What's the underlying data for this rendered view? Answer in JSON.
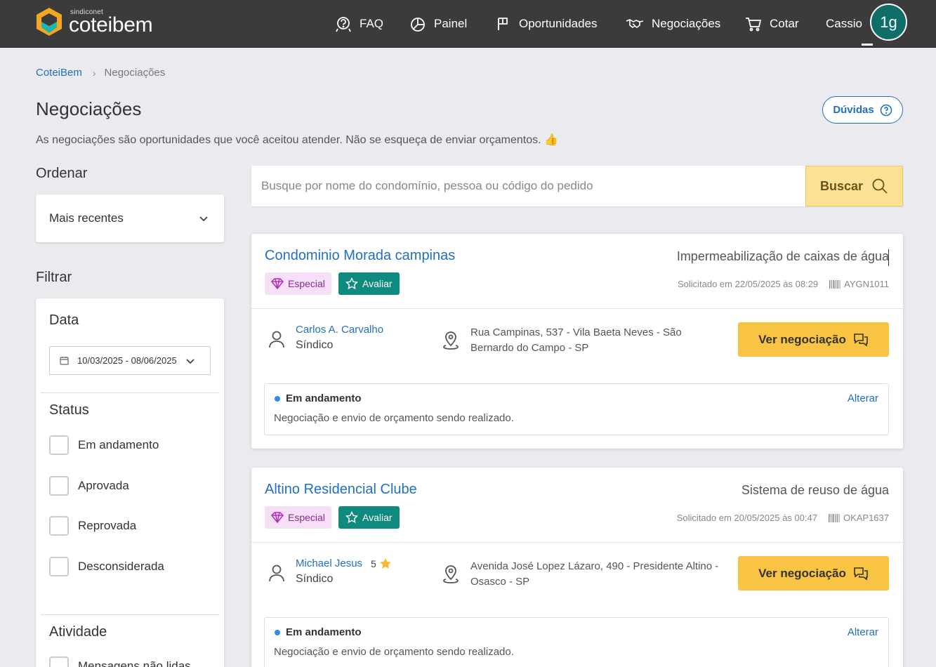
{
  "header": {
    "brand_small": "sindiconet",
    "brand_name": "coteibem",
    "nav": {
      "faq": "FAQ",
      "painel": "Painel",
      "oportunidades": "Oportunidades",
      "negociacoes": "Negociações",
      "cotar": "Cotar"
    },
    "user_name": "Cassio",
    "avatar_initials": "1g"
  },
  "breadcrumb": {
    "home": "CoteiBem",
    "separator": "›",
    "current": "Negociações"
  },
  "page": {
    "title": "Negociações",
    "subtitle": "As negociações são oportunidades que você aceitou atender. Não se esqueça de enviar orçamentos. 👍",
    "help_button": "Dúvidas"
  },
  "sidebar": {
    "sort_label": "Ordenar",
    "sort_value": "Mais recentes",
    "filter_label": "Filtrar",
    "date_label": "Data",
    "date_range": "10/03/2025 - 08/06/2025",
    "status_label": "Status",
    "status_options": [
      "Em andamento",
      "Aprovada",
      "Reprovada",
      "Desconsiderada"
    ],
    "activity_label": "Atividade",
    "activity_options": [
      "Mensagens não lidas"
    ]
  },
  "search": {
    "placeholder": "Busque por nome do condomínio, pessoa ou código do pedido",
    "button": "Buscar"
  },
  "cards": [
    {
      "title": "Condominio Morada campinas",
      "service": "Impermeabilização de caixas de água",
      "tag_especial": "Especial",
      "tag_avaliar": "Avaliar",
      "requested": "Solicitado em 22/05/2025 às 08:29",
      "code": "AYGN1011",
      "person": "Carlos A. Carvalho",
      "role": "Síndico",
      "rating": "",
      "address": "Rua Campinas, 537 - Vila Baeta Neves - São Bernardo do Campo - SP",
      "action": "Ver negociação",
      "status": "Em andamento",
      "status_desc": "Negociação e envio de orçamento sendo realizado.",
      "change": "Alterar"
    },
    {
      "title": "Altino Residencial Clube",
      "service": "Sistema de reuso de água",
      "tag_especial": "Especial",
      "tag_avaliar": "Avaliar",
      "requested": "Solicitado em 20/05/2025 às 00:47",
      "code": "OKAP1637",
      "person": "Michael Jesus",
      "role": "Síndico",
      "rating": "5",
      "address": "Avenida José Lopez Lázaro, 490 - Presidente Altino - Osasco - SP",
      "action": "Ver negociação",
      "status": "Em andamento",
      "status_desc": "Negociação e envio de orçamento sendo realizado.",
      "change": "Alterar"
    }
  ],
  "colors": {
    "header_bg": "#3b3b3b",
    "link": "#1f6fc4",
    "primary_button": "#f9c443",
    "avaliar_tag": "#0f8a7e",
    "especial_tag": "#f6e0f7",
    "status_dot": "#2e8de6"
  }
}
